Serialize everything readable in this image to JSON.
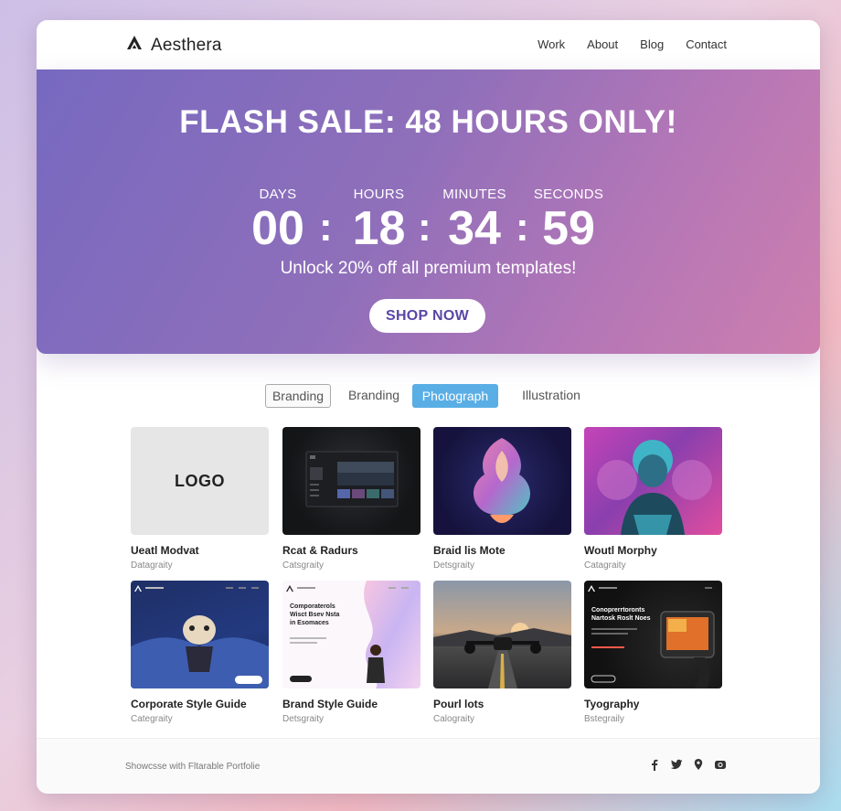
{
  "header": {
    "brand": "Aesthera",
    "nav": [
      "Work",
      "About",
      "Blog",
      "Contact"
    ]
  },
  "hero": {
    "title": "FLASH SALE: 48 HOURS ONLY!",
    "countdown": [
      {
        "label": "DAYS",
        "value": "00"
      },
      {
        "label": "HOURS",
        "value": "18"
      },
      {
        "label": "MINUTES",
        "value": "34"
      },
      {
        "label": "SECONDS",
        "value": "59"
      }
    ],
    "separator": ":",
    "subtitle": "Unlock 20% off all premium templates!",
    "cta": "SHOP NOW"
  },
  "filters": [
    {
      "label": "Branding",
      "state": "outlined"
    },
    {
      "label": "Branding",
      "state": "plain"
    },
    {
      "label": "Photograph",
      "state": "active"
    },
    {
      "label": "Illustration",
      "state": "plain"
    }
  ],
  "portfolio": [
    {
      "title": "Ueatl Modvat",
      "category": "Datagraity",
      "thumb_text": "LOGO"
    },
    {
      "title": "Rcat & Radurs",
      "category": "Catsgraity"
    },
    {
      "title": "Braid lis Mote",
      "category": "Detsgraity"
    },
    {
      "title": "Woutl Morphy",
      "category": "Catagraity"
    },
    {
      "title": "Corporate Style Guide",
      "category": "Categraity"
    },
    {
      "title": "Brand Style Guide",
      "category": "Detsgraity",
      "thumb_text": "Comporaterols Wisct Bsev Nsta in Esomaces"
    },
    {
      "title": "Pourl lots",
      "category": "Calograity"
    },
    {
      "title": "Tyography",
      "category": "Bstegraily",
      "thumb_text": "Conoprerrtoronts Nartosk Roslt Noes"
    }
  ],
  "footer": {
    "text": "Showcsse with Fltarable Portfolie",
    "socials": [
      "facebook-icon",
      "twitter-icon",
      "location-icon",
      "camera-icon"
    ]
  },
  "colors": {
    "hero_start": "#7769c0",
    "hero_end": "#cd7fae",
    "active_tab": "#5aaee6",
    "cta_text": "#5a46a6"
  }
}
